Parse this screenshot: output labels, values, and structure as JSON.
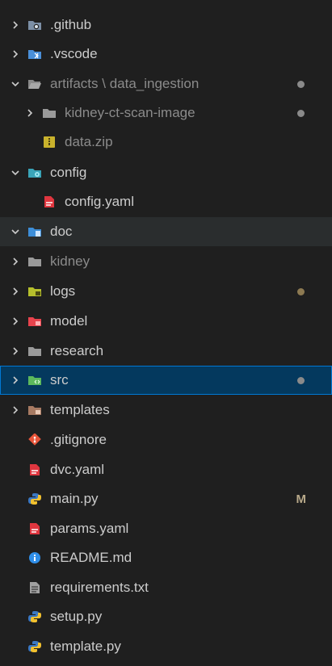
{
  "colors": {
    "background": "#1f1f1f",
    "selected_bg": "#04395e",
    "selected_border": "#0078d4",
    "dim_text": "#8b8b8b",
    "dot_gray": "#8a8a8a",
    "dot_gold": "#8d7a52",
    "modified": "#b8a98a"
  },
  "tree": [
    {
      "label": ".github",
      "chevron": "right",
      "icon": "github-folder-icon",
      "level": 0
    },
    {
      "label": ".vscode",
      "chevron": "right",
      "icon": "vscode-folder-icon",
      "level": 0
    },
    {
      "label": "artifacts",
      "label_suffix": "data_ingestion",
      "chevron": "down",
      "icon": "folder-open-icon",
      "level": 0,
      "dim": true,
      "dot": "gray"
    },
    {
      "label": "kidney-ct-scan-image",
      "chevron": "right",
      "icon": "folder-icon",
      "level": 1,
      "dim": true,
      "dot": "gray"
    },
    {
      "label": "data.zip",
      "chevron": "none",
      "icon": "zip-icon",
      "level": 1,
      "dim": true
    },
    {
      "label": "config",
      "chevron": "down",
      "icon": "config-folder-icon",
      "level": 0
    },
    {
      "label": "config.yaml",
      "chevron": "none",
      "icon": "yaml-icon",
      "level": 1
    },
    {
      "label": "doc",
      "chevron": "down",
      "icon": "doc-folder-icon",
      "level": 0,
      "state": "hover"
    },
    {
      "label": "kidney",
      "chevron": "right",
      "icon": "folder-icon",
      "level": 0,
      "dim": true
    },
    {
      "label": "logs",
      "chevron": "right",
      "icon": "logs-folder-icon",
      "level": 0,
      "dot": "gold"
    },
    {
      "label": "model",
      "chevron": "right",
      "icon": "model-folder-icon",
      "level": 0
    },
    {
      "label": "research",
      "chevron": "right",
      "icon": "folder-icon",
      "level": 0
    },
    {
      "label": "src",
      "chevron": "right",
      "icon": "src-folder-icon",
      "level": 0,
      "state": "selected",
      "dot": "gray"
    },
    {
      "label": "templates",
      "chevron": "right",
      "icon": "templates-folder-icon",
      "level": 0
    },
    {
      "label": ".gitignore",
      "chevron": "none",
      "icon": "git-icon",
      "level": 0
    },
    {
      "label": "dvc.yaml",
      "chevron": "none",
      "icon": "yaml-icon",
      "level": 0
    },
    {
      "label": "main.py",
      "chevron": "none",
      "icon": "python-icon",
      "level": 0,
      "modified": "M"
    },
    {
      "label": "params.yaml",
      "chevron": "none",
      "icon": "yaml-icon",
      "level": 0
    },
    {
      "label": "README.md",
      "chevron": "none",
      "icon": "info-icon",
      "level": 0
    },
    {
      "label": "requirements.txt",
      "chevron": "none",
      "icon": "text-file-icon",
      "level": 0
    },
    {
      "label": "setup.py",
      "chevron": "none",
      "icon": "python-icon",
      "level": 0
    },
    {
      "label": "template.py",
      "chevron": "none",
      "icon": "python-icon",
      "level": 0
    }
  ]
}
